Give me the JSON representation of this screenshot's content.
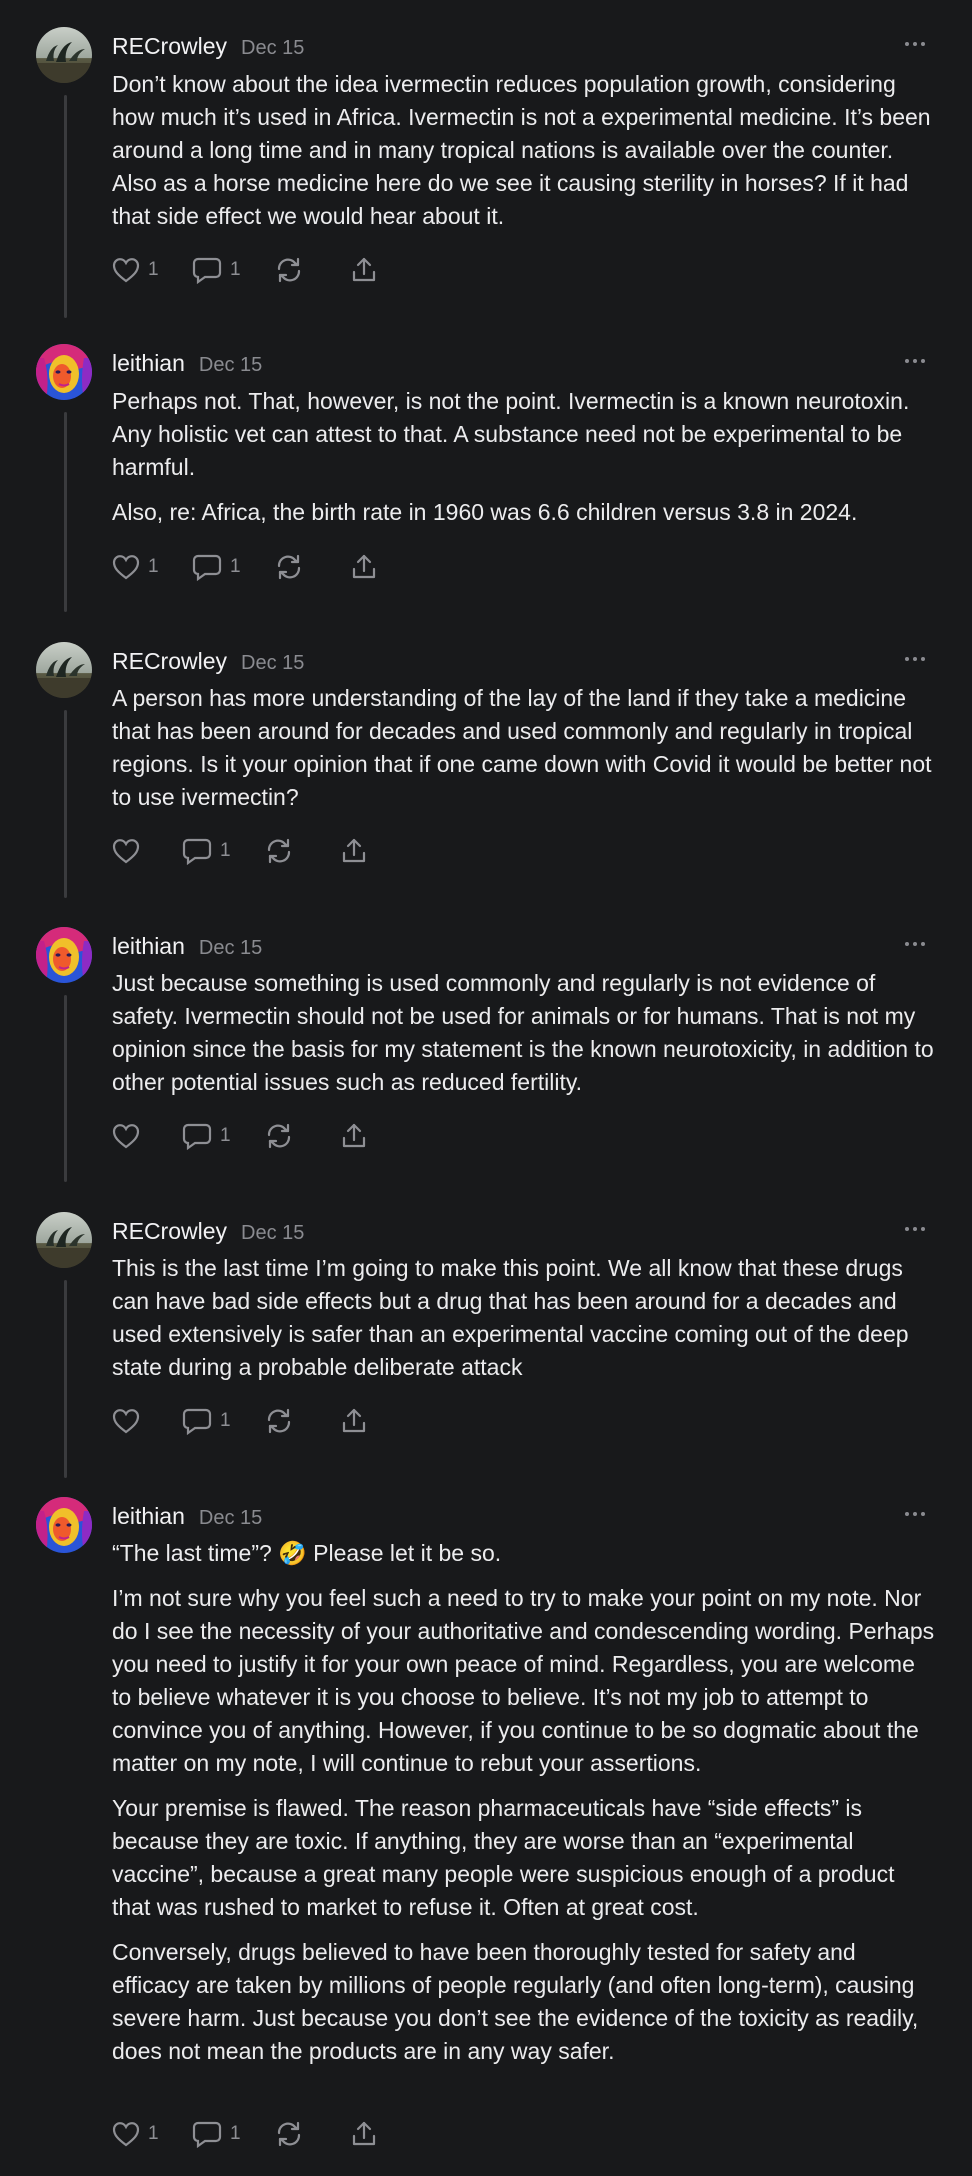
{
  "posts": [
    {
      "author": "RECrowley",
      "date": "Dec 15",
      "paragraphs": [
        "Don’t know about the idea ivermectin reduces population growth, considering how much it’s used in Africa. Ivermectin is not a experimental medicine. It’s been around a long time and in many tropical nations is available over the counter. Also as a horse medicine here do we see it causing sterility in horses? If it had that side effect we would hear about it."
      ],
      "likes": "1",
      "replies": "1"
    },
    {
      "author": "leithian",
      "date": "Dec 15",
      "paragraphs": [
        "Perhaps not. That, however, is not the point. Ivermectin is a known neurotoxin. Any holistic vet can attest to that. A substance need not be experimental to be harmful.",
        "Also, re: Africa, the birth rate in 1960 was 6.6 children versus 3.8 in 2024."
      ],
      "likes": "1",
      "replies": "1"
    },
    {
      "author": "RECrowley",
      "date": "Dec 15",
      "paragraphs": [
        "A person has more understanding of the lay of the land if they take a medicine that has been around for decades and used commonly and regularly in tropical regions. Is it your opinion that if one came down with Covid it would be better not to use ivermectin?"
      ],
      "likes": "",
      "replies": "1"
    },
    {
      "author": "leithian",
      "date": "Dec 15",
      "paragraphs": [
        "Just because something is used commonly and regularly is not evidence of safety. Ivermectin should not be used for animals or for humans. That is not my opinion since the basis for my statement is the known neurotoxicity, in addition to other potential issues such as reduced fertility."
      ],
      "likes": "",
      "replies": "1"
    },
    {
      "author": "RECrowley",
      "date": "Dec 15",
      "paragraphs": [
        "This is the last time I’m going to make this point. We all know that these drugs can have bad side effects but a drug that has been around for a decades and used extensively is safer than an experimental vaccine coming out of the deep state during a probable deliberate attack"
      ],
      "likes": "",
      "replies": "1"
    },
    {
      "author": "leithian",
      "date": "Dec 15",
      "paragraphs": [
        "“The last time”? 🤣 Please let it be so.",
        "I’m not sure why you feel such a need to try to make your point on my note. Nor do I see the necessity of your authoritative and condescending wording. Perhaps you need to justify it for your own peace of mind. Regardless, you are welcome to believe whatever it is you choose to believe. It’s not my job to attempt to convince you of anything. However, if you continue to be so dogmatic about the matter on my note, I will continue to rebut your assertions.",
        "Your premise is flawed. The reason pharmaceuticals have “side effects” is because they are toxic. If anything, they are worse than an “experimental vaccine”, because a great many people were suspicious enough of a product that was rushed to market to refuse it. Often at great cost.",
        "Conversely, drugs believed to have been thoroughly tested for safety and efficacy are taken by millions of people regularly (and often long-term), causing severe harm. Just because you don’t see the evidence of the toxicity as readily, does not mean the products are in any way safer."
      ],
      "likes": "1",
      "replies": "1"
    }
  ],
  "icons": {
    "like": "heart-icon",
    "reply": "comment-icon",
    "restack": "restack-icon",
    "share": "share-icon",
    "more": "more-icon"
  },
  "colors": {
    "background": "#18191b",
    "text": "#f0f0f2",
    "muted": "#8a8b90",
    "rail": "#3a3b3e"
  }
}
